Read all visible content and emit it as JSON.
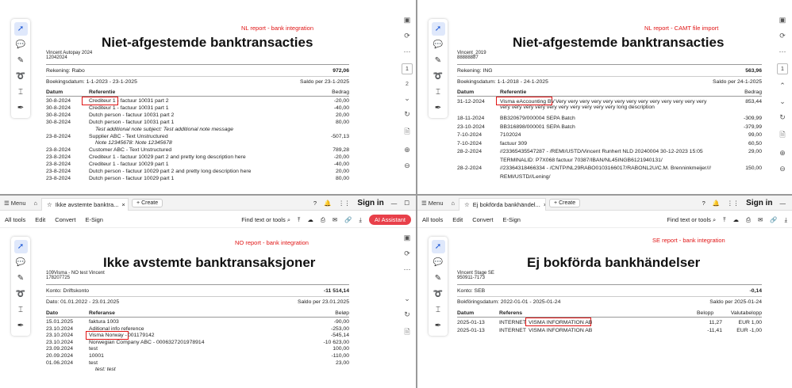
{
  "toolbar": {
    "menu": "Menu",
    "create": "Create",
    "all_tools": "All tools",
    "edit": "Edit",
    "convert": "Convert",
    "esign": "E-Sign",
    "find": "Find text or tools",
    "sign_in": "Sign in",
    "ai_assistant": "AI Assistant"
  },
  "q1": {
    "label": "NL report - bank integration",
    "title": "Niet-afgestemde banktransacties",
    "company": "Vincent Autopay 2024",
    "company_id": "12042024",
    "account_label": "Rekening: Rabo",
    "account_amount": "972,06",
    "period": "Boekingsdatum: 1-1-2023 - 23-1-2025",
    "saldo": "Saldo per 23-1-2025",
    "col_date": "Datum",
    "col_ref": "Referentie",
    "col_amount": "Bedrag",
    "page1": "1",
    "page2": "2",
    "rows": [
      {
        "d": "30-8-2024",
        "r": "Crediteur 1 - factuur 10031 part 2",
        "a": "-20,00"
      },
      {
        "d": "30-8-2024",
        "r": "Crediteur 1 - factuur 10031 part 1",
        "a": "-40,00"
      },
      {
        "d": "30-8-2024",
        "r": "Dutch person - factuur 10031 part 2",
        "a": "20,00"
      },
      {
        "d": "30-8-2024",
        "r": "Dutch person - factuur 10031 part 1",
        "a": "80,00"
      },
      {
        "d": "",
        "r": "Test additional note subject: Test additional note message",
        "a": ""
      },
      {
        "d": "23-8-2024",
        "r": "Supplier ABC - Text Unstructured",
        "a": "-507,13"
      },
      {
        "d": "",
        "r": "Note 12345678: Note 12345678",
        "a": ""
      },
      {
        "d": "23-8-2024",
        "r": "Customer ABC - Text Unstructured",
        "a": "789,28"
      },
      {
        "d": "23-8-2024",
        "r": "Crediteur 1 - factuur 10029 part 2 and pretty long description here",
        "a": "-20,00"
      },
      {
        "d": "23-8-2024",
        "r": "Crediteur 1 - factuur 10029 part 1",
        "a": "-40,00"
      },
      {
        "d": "23-8-2024",
        "r": "Dutch person - factuur 10029 part 2 and pretty long description here",
        "a": "20,00"
      },
      {
        "d": "23-8-2024",
        "r": "Dutch person - factuur 10029 part 1",
        "a": "80,00"
      }
    ]
  },
  "q2": {
    "label": "NL report - CAMT file import",
    "title": "Niet-afgestemde banktransacties",
    "company": "Vincent_2019",
    "company_id": "88888887",
    "account_label": "Rekening: ING",
    "account_amount": "563,96",
    "period": "Boekingsdatum: 1-1-2018 - 24-1-2025",
    "saldo": "Saldo per 24-1-2025",
    "col_date": "Datum",
    "col_ref": "Referentie",
    "col_amount": "Bedrag",
    "page1": "1",
    "highlight": "Visma eAccounting BV",
    "r0_rest1": "Very very very very very very very very very very very very very",
    "r0_rest2": "very very very very very very very very very very  long description",
    "r0_amount": "853,44",
    "rows": [
      {
        "d": "18-11-2024",
        "r": "BB320679/000004 SEPA Batch",
        "a": "-309,99"
      },
      {
        "d": "23-10-2024",
        "r": "BB316898/000001 SEPA Batch",
        "a": "-379,99"
      },
      {
        "d": "7-10-2024",
        "r": "7102024",
        "a": "99,00"
      },
      {
        "d": "7-10-2024",
        "r": "factuur 309",
        "a": "60,50"
      },
      {
        "d": "28-2-2024",
        "r": "//23365435547287 - /REMI/USTD/Vincent Runhert NLD 20240004 30-12-2023 15:05",
        "a": "29,00"
      },
      {
        "d": "",
        "r": "TERMINALID: P7X068 factuur 70387/IBAN/NL45INGB6121940131/",
        "a": ""
      },
      {
        "d": "28-2-2024",
        "r": "//23364318466334 - /CNTP/NL29RABO0103166017/RABONL2U/C.M. Brenninkmeijer///",
        "a": "150,00"
      },
      {
        "d": "",
        "r": "REMI/USTD//Lening/",
        "a": ""
      }
    ]
  },
  "q3": {
    "tab_title": "Ikke avstemte banktra...",
    "label": "NO report - bank integration",
    "title": "Ikke avstemte banktransaksjoner",
    "company": "109Visma - NO test Vincent",
    "company_id": "178207725",
    "account_label": "Konto: Driftskonto",
    "account_amount": "-11 514,14",
    "period": "Dato: 01.01.2022 - 23.01.2025",
    "saldo": "Saldo per 23.01.2025",
    "col_date": "Dato",
    "col_ref": "Referanse",
    "col_amount": "Beløp",
    "highlight": "Visma Norway -",
    "hl_rest": "001179142",
    "hl_date": "23.10.2024",
    "hl_amount": "-545,14",
    "rows_before": [
      {
        "d": "15.01.2025",
        "r": "faktura 1003",
        "a": "-90,00"
      },
      {
        "d": "23.10.2024",
        "r": "Aditional info reference",
        "a": "-253,00"
      }
    ],
    "rows_after": [
      {
        "d": "23.10.2024",
        "r": "Norwegian Company ABC - 0006327201978914",
        "a": "-10 623,00"
      },
      {
        "d": "23.09.2024",
        "r": "test",
        "a": "100,00"
      },
      {
        "d": "20.09.2024",
        "r": "10001",
        "a": "-110,00"
      },
      {
        "d": "01.06.2024",
        "r": "test",
        "a": "23,00"
      },
      {
        "d": "",
        "r": "test: test",
        "a": ""
      }
    ]
  },
  "q4": {
    "tab_title": "Ej bokförda bankhändel...",
    "label": "SE report - bank integration",
    "title": "Ej bokförda bankhändelser",
    "company": "Vincent Stage  SE",
    "company_id": "950911-7173",
    "account_label": "Konto: SEB",
    "account_amount": "-0,14",
    "period": "Bokföringsdatum: 2022-01-01 - 2025-01-24",
    "saldo": "Saldo per 2025-01-24",
    "col_date": "Datum",
    "col_ref": "Referens",
    "col_amount": "Belopp",
    "col_currency": "Valutabelopp",
    "rows": [
      {
        "d": "2025-01-13",
        "t": "INTERNET",
        "r": "VISMA INFORMATION AB",
        "a": "11,27",
        "c": "EUR 1,00"
      },
      {
        "d": "2025-01-13",
        "t": "INTERNET",
        "r": "VISMA INFORMATION AB",
        "a": "-11,41",
        "c": "EUR -1,00"
      }
    ]
  }
}
